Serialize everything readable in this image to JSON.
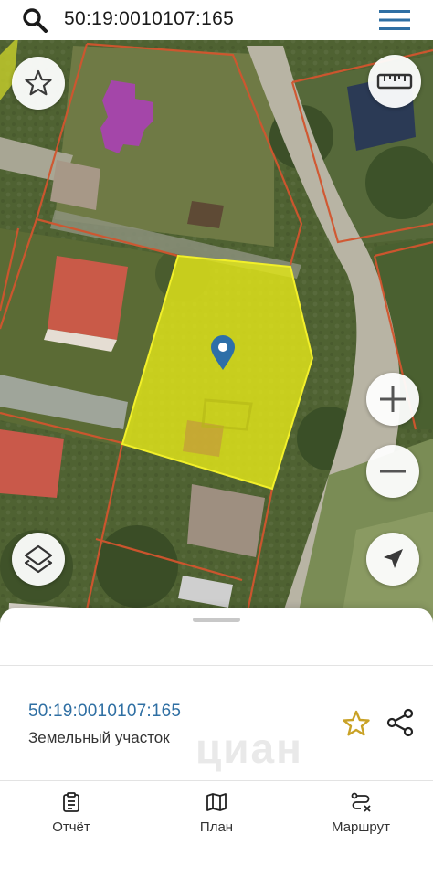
{
  "search": {
    "query": "50:19:0010107:165"
  },
  "map": {
    "parcel_fill": "#e3e61a",
    "parcel_border": "#f2f02a",
    "boundary_color": "#d2552e",
    "neighbor_fill": "#b23ac2",
    "marker_color": "#2d6fa8"
  },
  "controls": {
    "favorite": "star-icon",
    "ruler": "ruler-icon",
    "zoom_in": "plus-icon",
    "zoom_out": "minus-icon",
    "layers": "layers-icon",
    "locate": "navigation-arrow-icon"
  },
  "object": {
    "cadastral_number": "50:19:0010107:165",
    "type": "Земельный участок",
    "star_color": "#c9a227"
  },
  "tabs": [
    {
      "label": "Отчёт",
      "icon": "report-clipboard-icon"
    },
    {
      "label": "План",
      "icon": "map-plan-icon"
    },
    {
      "label": "Маршрут",
      "icon": "route-icon"
    }
  ]
}
